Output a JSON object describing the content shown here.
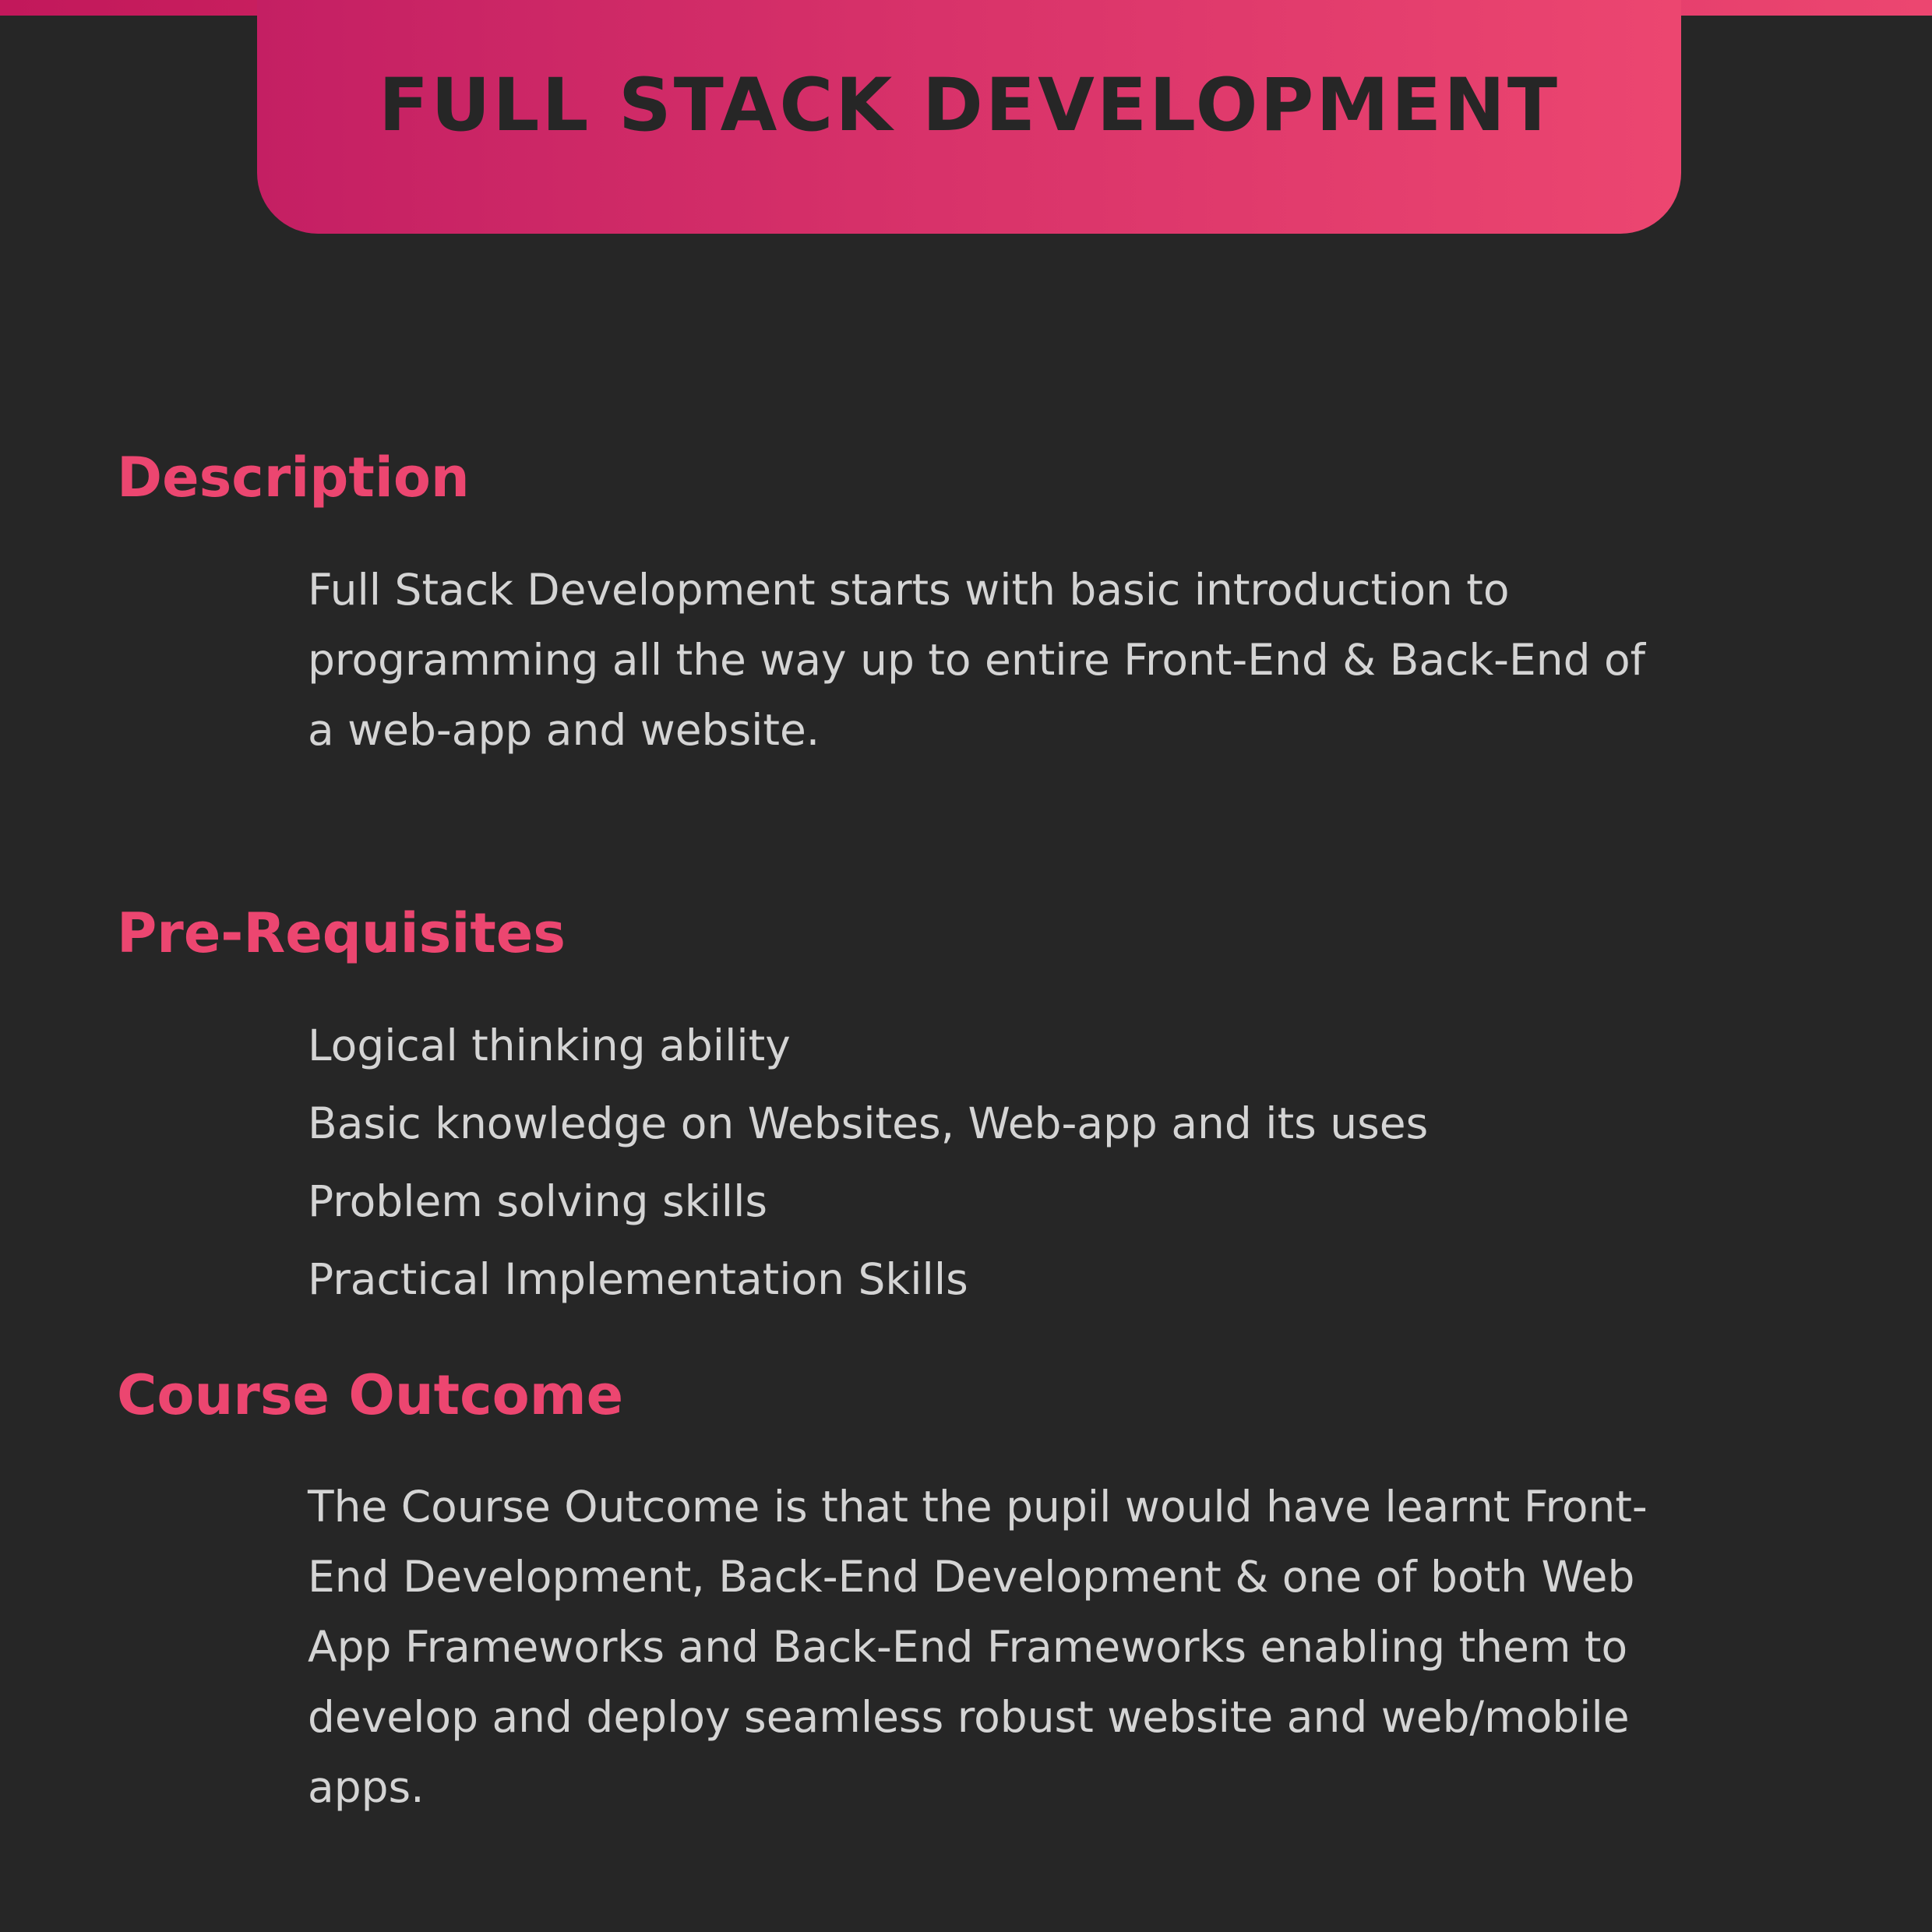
{
  "title": "FULL STACK DEVELOPMENT",
  "colors": {
    "background": "#262626",
    "accent": "#ec4670",
    "accent_dark": "#c2185b",
    "body_text": "#d4d4d4"
  },
  "description": {
    "heading": "Description",
    "text": "Full Stack Development starts with basic introduction to programming all the way up to entire Front-End & Back-End of a web-app and website."
  },
  "prerequisites": {
    "heading": "Pre-Requisites",
    "items": [
      "Logical thinking ability",
      "Basic knowledge on Websites, Web-app and its uses",
      "Problem solving skills",
      "Practical Implementation Skills"
    ]
  },
  "outcome": {
    "heading": "Course Outcome",
    "text": "The Course Outcome is that the pupil would have learnt Front-End Development, Back-End Development & one of both Web App Frameworks and Back-End Frameworks enabling them to develop and deploy seamless robust website and web/mobile apps."
  }
}
